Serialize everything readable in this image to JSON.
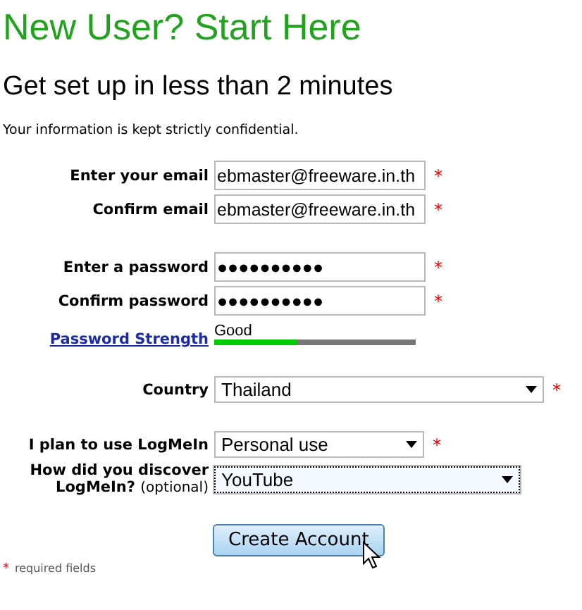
{
  "heading": "New User? Start Here",
  "subheading": "Get set up in less than 2 minutes",
  "notice": "Your information is kept strictly confidential.",
  "rows": [
    {
      "kind": "text",
      "label": "Enter your email",
      "value": "ebmaster@freeware.in.th",
      "required_mark": "*"
    },
    {
      "kind": "text",
      "label": "Confirm email",
      "value": "ebmaster@freeware.in.th",
      "required_mark": "*"
    },
    {
      "kind": "gap"
    },
    {
      "kind": "text",
      "label": "Enter a password",
      "value": "●●●●●●●●●●",
      "required_mark": "*"
    },
    {
      "kind": "text",
      "label": "Confirm password",
      "value": "●●●●●●●●●●",
      "required_mark": "*"
    },
    {
      "kind": "strength",
      "link": "Password Strength",
      "reading": "Good",
      "level": 0.41
    },
    {
      "kind": "gap"
    },
    {
      "kind": "select",
      "label": "Country",
      "value": "Thailand",
      "required_mark": "*",
      "focused": false
    },
    {
      "kind": "gap"
    },
    {
      "kind": "select",
      "label": "I plan to use LogMeIn",
      "value": "Personal use",
      "required_mark": "*",
      "focused": false
    },
    {
      "kind": "select",
      "label": "How did you discover LogMeIn?",
      "note": "(optional)",
      "value": "YouTube",
      "focused": true
    }
  ],
  "submit": "Create Account",
  "footnote": {
    "mark": "*",
    "text": "required fields"
  }
}
